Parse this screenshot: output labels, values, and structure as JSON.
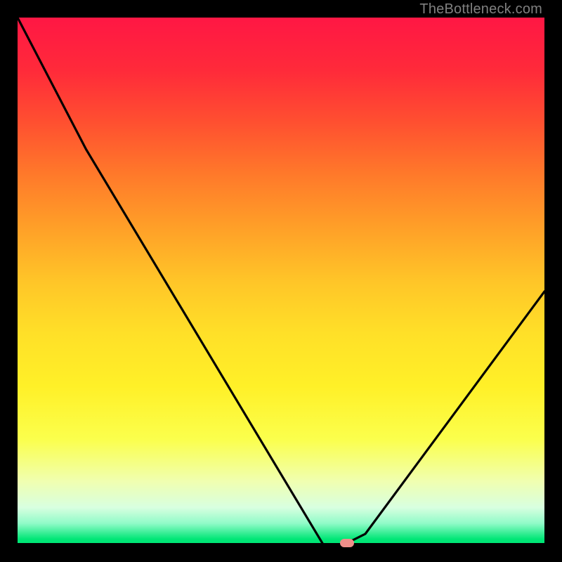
{
  "watermark": "TheBottleneck.com",
  "chart_data": {
    "type": "line",
    "title": "",
    "xlabel": "",
    "ylabel": "",
    "xlim": [
      0,
      100
    ],
    "ylim": [
      0,
      100
    ],
    "grid": false,
    "legend": false,
    "background": "red-yellow-green vertical gradient",
    "series": [
      {
        "name": "bottleneck-curve",
        "color": "#000000",
        "x": [
          0,
          13,
          58,
          62,
          66,
          100
        ],
        "y": [
          100,
          75,
          0,
          0,
          2,
          48
        ]
      }
    ],
    "marker": {
      "name": "optimal-point",
      "shape": "rounded-rect",
      "color": "#ef8f8a",
      "x": 62.5,
      "y": 0
    }
  }
}
